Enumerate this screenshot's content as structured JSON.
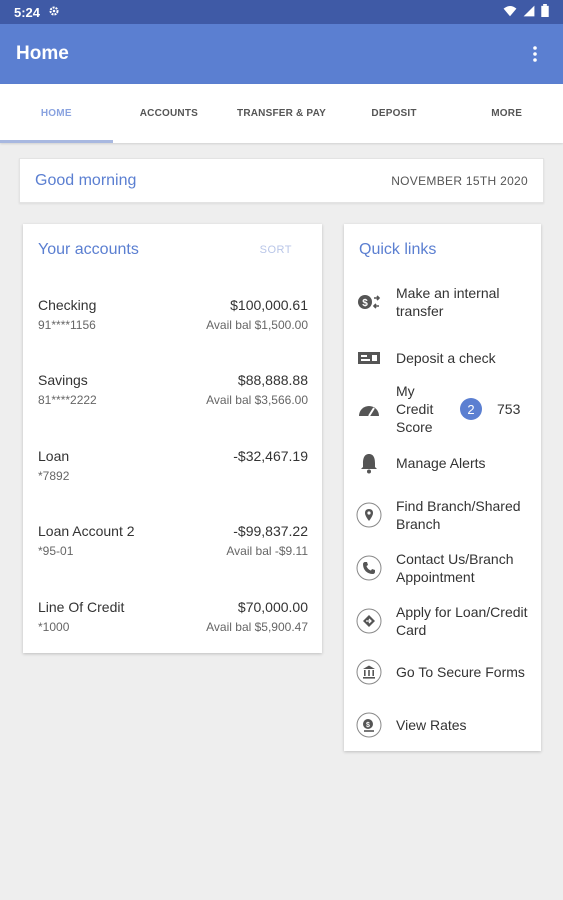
{
  "status_bar": {
    "time": "5:24"
  },
  "app_bar": {
    "title": "Home"
  },
  "tabs": [
    {
      "label": "HOME"
    },
    {
      "label": "ACCOUNTS"
    },
    {
      "label": "TRANSFER & PAY"
    },
    {
      "label": "DEPOSIT"
    },
    {
      "label": "MORE"
    }
  ],
  "greeting": {
    "text": "Good morning",
    "date": "NOVEMBER 15TH 2020"
  },
  "accounts": {
    "title": "Your accounts",
    "sort_label": "SORT",
    "items": [
      {
        "name": "Checking",
        "number": "91****1156",
        "balance": "$100,000.61",
        "avail": "Avail bal $1,500.00"
      },
      {
        "name": "Savings",
        "number": "81****2222",
        "balance": "$88,888.88",
        "avail": "Avail bal $3,566.00"
      },
      {
        "name": "Loan",
        "number": "*7892",
        "balance": "-$32,467.19",
        "avail": ""
      },
      {
        "name": "Loan Account 2",
        "number": "*95-01",
        "balance": "-$99,837.22",
        "avail": "Avail bal -$9.11"
      },
      {
        "name": "Line Of Credit",
        "number": "*1000",
        "balance": "$70,000.00",
        "avail": "Avail bal $5,900.47"
      }
    ]
  },
  "quick_links": {
    "title": "Quick links",
    "items": [
      {
        "label": "Make an internal transfer",
        "icon": "transfer-icon"
      },
      {
        "label": "Deposit a check",
        "icon": "check-icon"
      },
      {
        "label": "My Credit Score",
        "icon": "gauge-icon",
        "badge": "2",
        "score": "753"
      },
      {
        "label": "Manage Alerts",
        "icon": "bell-icon"
      },
      {
        "label": "Find Branch/Shared Branch",
        "icon": "location-icon"
      },
      {
        "label": "Contact Us/Branch Appointment",
        "icon": "phone-icon"
      },
      {
        "label": "Apply for Loan/Credit Card",
        "icon": "apply-icon"
      },
      {
        "label": "Go To Secure Forms",
        "icon": "bank-icon"
      },
      {
        "label": "View Rates",
        "icon": "rates-icon"
      }
    ]
  },
  "colors": {
    "primary": "#5b7fd1",
    "status_bar": "#3f5aa6",
    "background": "#eeeeee"
  }
}
